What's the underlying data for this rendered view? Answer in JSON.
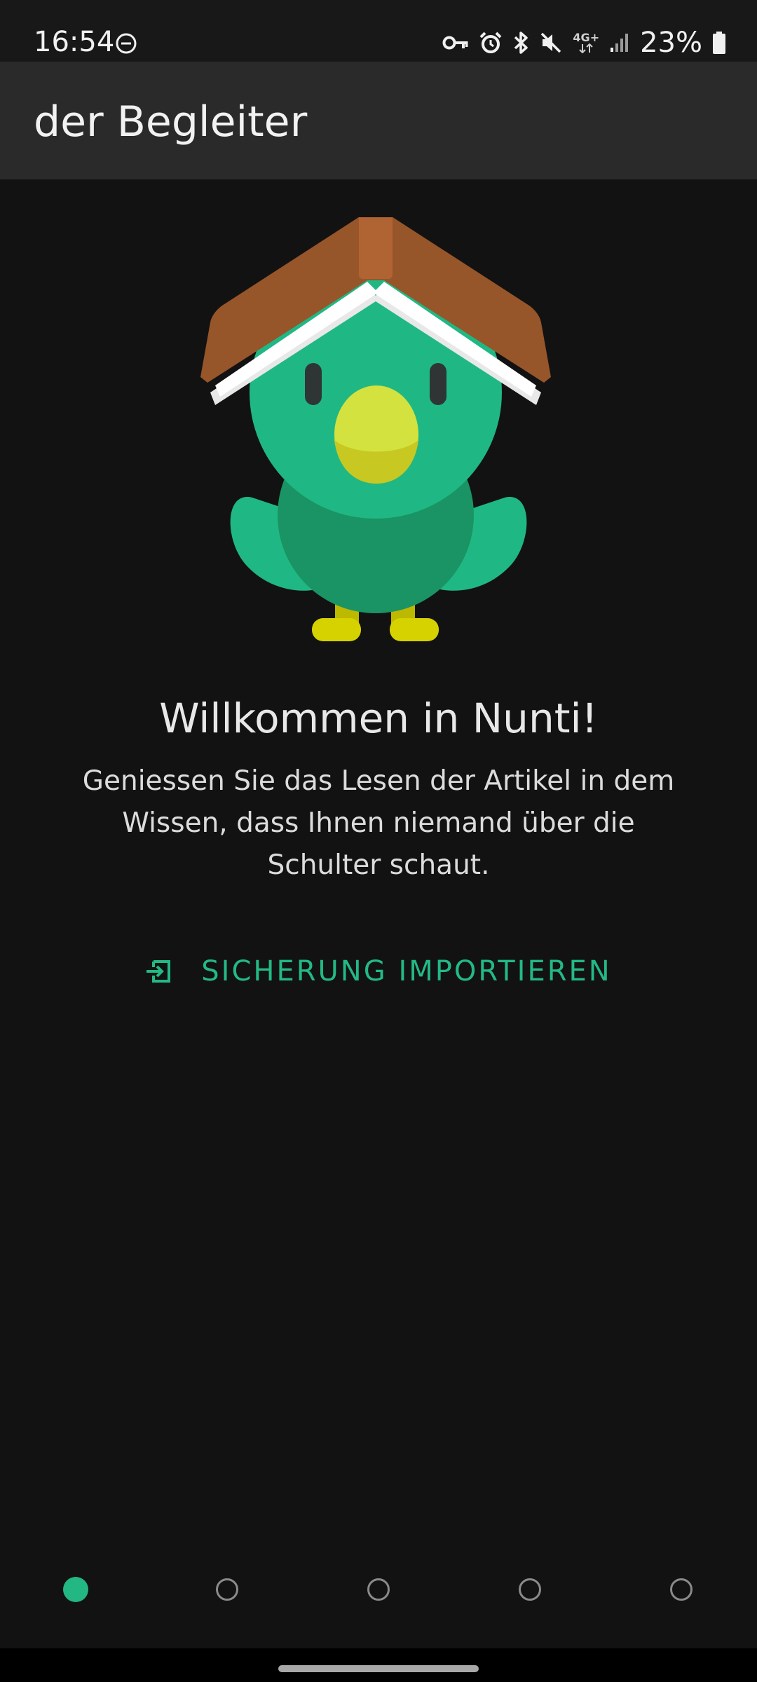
{
  "status_bar": {
    "time": "16:54",
    "network_label": "4G+",
    "battery_percent": "23%",
    "icons": [
      "do-not-disturb-icon",
      "vpn-key-icon",
      "alarm-icon",
      "bluetooth-icon",
      "mute-icon",
      "network-4g-icon",
      "signal-icon",
      "battery-icon"
    ]
  },
  "app_bar": {
    "title": "der Begleiter"
  },
  "welcome": {
    "title": "Willkommen in Nunti!",
    "body": "Geniessen Sie das Lesen der Artikel in dem Wissen, dass Ihnen niemand über die Schulter schaut."
  },
  "import_button": {
    "label": "SICHERUNG IMPORTIEREN",
    "icon": "import-icon"
  },
  "pager": {
    "total": 5,
    "active_index": 0
  },
  "colors": {
    "accent": "#22b783",
    "background": "#121212",
    "app_bar": "#2a2a2a"
  }
}
